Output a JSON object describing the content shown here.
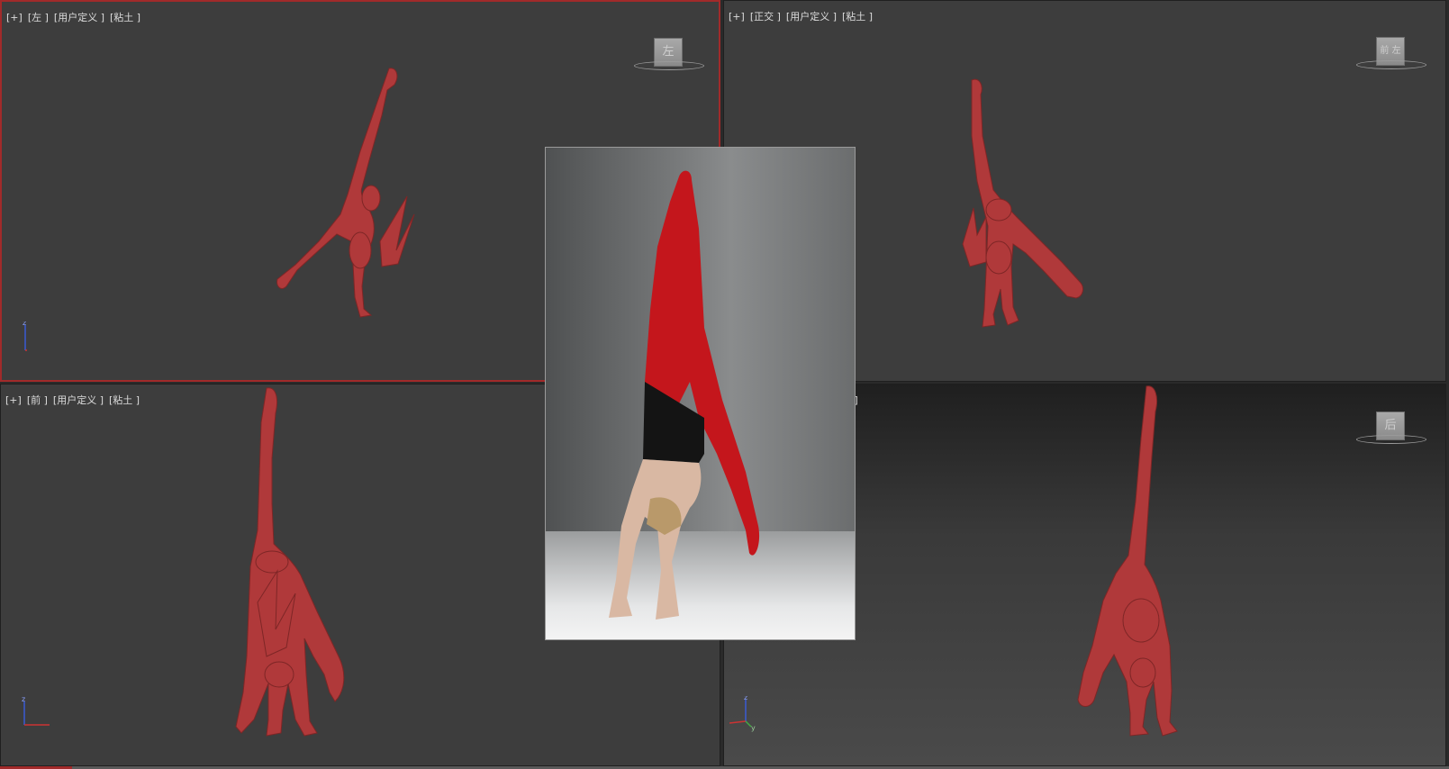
{
  "viewports": {
    "top_left": {
      "labels": [
        "[+]",
        "[左 ]",
        "[用户定义 ]",
        "[粘土 ]"
      ],
      "cube_face": "左"
    },
    "top_right": {
      "labels": [
        "[+]",
        "[正交 ]",
        "[用户定义 ]",
        "[粘土 ]"
      ],
      "cube_face": "前 左"
    },
    "bottom_left": {
      "labels": [
        "[+]",
        "[前 ]",
        "[用户定义 ]",
        "[粘土 ]"
      ],
      "cube_face": ""
    },
    "bottom_right": {
      "labels": [
        "土 ]"
      ],
      "cube_face": "后"
    }
  },
  "axis": {
    "z_label": "z",
    "y_label": "y"
  },
  "colors": {
    "active_border": "#a12a2a",
    "clay": "#b0393a",
    "viewport_bg": "#3d3d3d"
  },
  "reference_image": {
    "subject": "handstand photo"
  }
}
